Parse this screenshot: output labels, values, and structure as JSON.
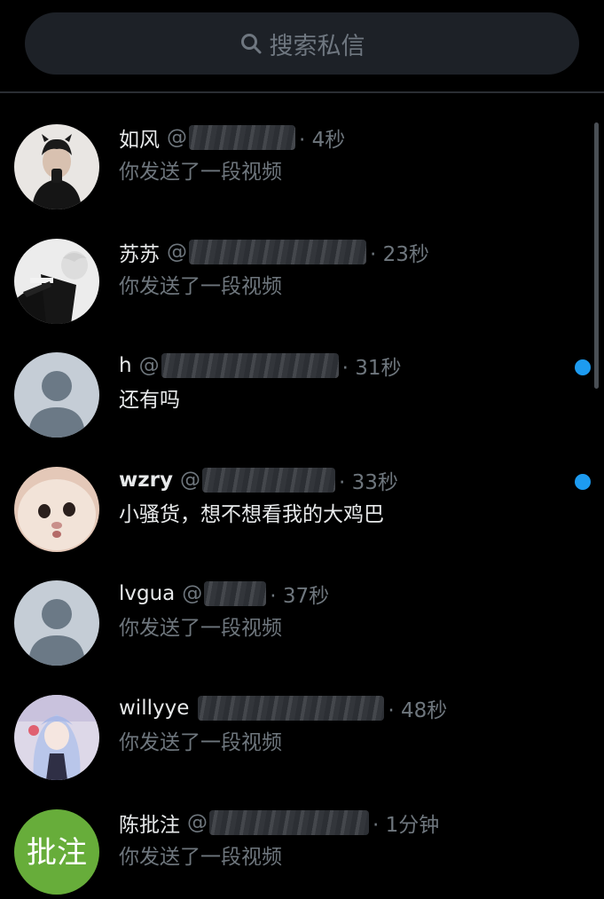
{
  "search": {
    "placeholder": "搜索私信",
    "icon": "search-icon"
  },
  "colors": {
    "background": "#000000",
    "search_bg": "#1d2127",
    "secondary_text": "#6e767d",
    "unread_dot": "#1d9bf0"
  },
  "conversations": [
    {
      "name": "如风",
      "handle": "@",
      "time": "· 4秒",
      "preview": "你发送了一段视频",
      "unread": false,
      "avatar": "photo-person-horns"
    },
    {
      "name": "苏苏",
      "handle": "@",
      "time": "· 23秒",
      "preview": "你发送了一段视频",
      "unread": false,
      "avatar": "photo-person-sitting"
    },
    {
      "name": "h",
      "handle": "@",
      "time": "· 31秒",
      "preview": "还有吗",
      "unread": true,
      "avatar": "default-avatar"
    },
    {
      "name": "wzry",
      "handle": "@",
      "time": "· 33秒",
      "preview": "小骚货，想不想看我的大鸡巴",
      "unread": true,
      "avatar": "photo-cat"
    },
    {
      "name": "lvgua",
      "handle": "@",
      "time": "· 37秒",
      "preview": "你发送了一段视频",
      "unread": false,
      "avatar": "default-avatar"
    },
    {
      "name": "willyye",
      "handle": "",
      "time": "· 48秒",
      "preview": "你发送了一段视频",
      "unread": false,
      "avatar": "photo-anime"
    },
    {
      "name": "陈批注",
      "handle": "@",
      "time": "· 1分钟",
      "preview": "你发送了一段视频",
      "unread": false,
      "avatar": "badge-pizhu",
      "avatar_text": "批注"
    }
  ]
}
